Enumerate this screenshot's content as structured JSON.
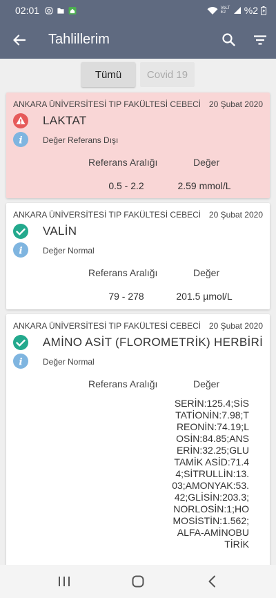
{
  "statusbar": {
    "time": "02:01",
    "lte_label": "VoLTE2",
    "battery": "%2"
  },
  "appbar": {
    "title": "Tahlillerim"
  },
  "tabs": [
    {
      "label": "Tümü",
      "selected": true
    },
    {
      "label": "Covid 19",
      "selected": false
    }
  ],
  "colors": {
    "appbar": "#5f6a80",
    "alert_bg": "#f9d6d6",
    "alert_icon": "#e65a5a",
    "ok_icon": "#23a98d",
    "info_icon": "#7fb5e0"
  },
  "results": [
    {
      "hospital": "ANKARA ÜNİVERSİTESİ TIP FAKÜLTESİ CEBECİ",
      "date": "20 Şubat 2020",
      "test": "LAKTAT",
      "status": "Değer Referans Dışı",
      "status_icon": "warning-icon",
      "ref_label": "Referans Aralığı",
      "val_label": "Değer",
      "ref_range": "0.5 - 2.2",
      "value": "2.59 mmol/L"
    },
    {
      "hospital": "ANKARA ÜNİVERSİTESİ TIP FAKÜLTESİ CEBECİ",
      "date": "20 Şubat 2020",
      "test": "VALİN",
      "status": "Değer Normal",
      "status_icon": "check-icon",
      "ref_label": "Referans Aralığı",
      "val_label": "Değer",
      "ref_range": "79 - 278",
      "value": "201.5 µmol/L"
    },
    {
      "hospital": "ANKARA ÜNİVERSİTESİ TIP FAKÜLTESİ CEBECİ",
      "date": "20 Şubat 2020",
      "test": "AMİNO ASİT (FLOROMETRİK) HERBİRİ",
      "status": "Değer Normal",
      "status_icon": "check-icon",
      "ref_label": "Referans Aralığı",
      "val_label": "Değer",
      "ref_range": "",
      "value": "SERİN:125.4;SİSTATİONİN:7.98;TREONİN:74.19;LOSİN:84.85;ANSERİN:32.25;GLUTAMİK ASİD:71.44;SİTRULLİN:13.03;AMONYAK:53.42;GLİSİN:203.3;NORLOSİN:1;HOMOSİSTİN:1.562;ALFA-AMİNOBUTİRİK"
    }
  ]
}
